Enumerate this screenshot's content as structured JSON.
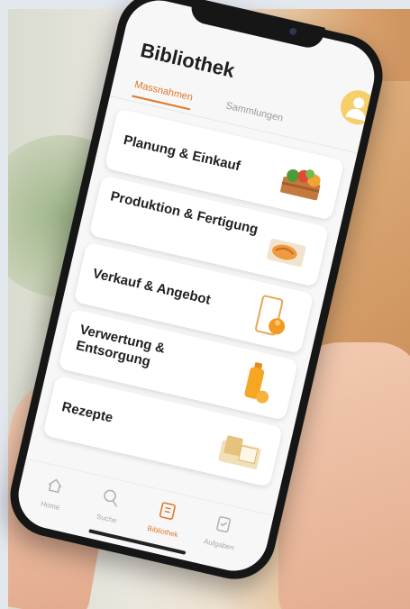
{
  "app": {
    "title": "Bibliothek",
    "accent_color": "#e0782c"
  },
  "tabs": [
    {
      "label": "Massnahmen",
      "active": true
    },
    {
      "label": "Sammlungen",
      "active": false
    }
  ],
  "categories": [
    {
      "label": "Planung & Einkauf",
      "icon": "vegetable-crate-icon"
    },
    {
      "label": "Produktion & Fertigung",
      "icon": "dough-icon"
    },
    {
      "label": "Verkauf & Angebot",
      "icon": "phone-orange-icon"
    },
    {
      "label": "Verwertung & Entsorgung",
      "icon": "juice-bottle-icon"
    },
    {
      "label": "Rezepte",
      "icon": "bread-basket-icon"
    }
  ],
  "bottom_nav": [
    {
      "label": "Home",
      "icon": "home-icon",
      "active": false
    },
    {
      "label": "Suche",
      "icon": "search-icon",
      "active": false
    },
    {
      "label": "Bibliothek",
      "icon": "book-icon",
      "active": true
    },
    {
      "label": "Aufgaben",
      "icon": "clipboard-icon",
      "active": false
    }
  ]
}
